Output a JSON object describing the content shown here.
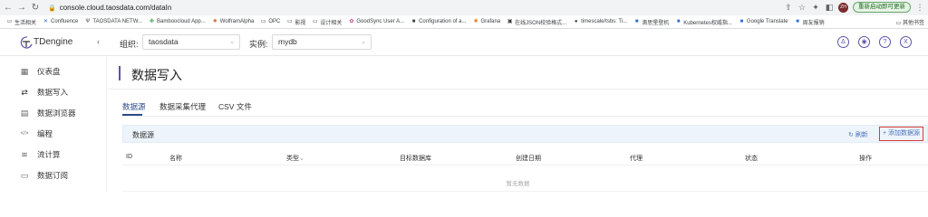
{
  "browser": {
    "url": "console.cloud.taosdata.com/dataIn",
    "update_button": "重新启动即可更新",
    "profile_initials": "ZH",
    "bookmarks": [
      "生活相关",
      "Confluence",
      "TAOSDATA NETW...",
      "Bamboocloud App...",
      "WolframAlpha",
      "OPC",
      "影视",
      "设计相关",
      "GoodSync User A...",
      "Configuration of a...",
      "Grafana",
      "在线JSON校验格式...",
      "timescale/tsbs: Ti...",
      "滴思堡登机",
      "Kubernetes权威指...",
      "Google Translate",
      "周友报销"
    ],
    "other_bookmarks": "其他书签"
  },
  "header": {
    "logo_text": "TDengine",
    "collapse_icon": "‹",
    "org_label": "组织:",
    "org_value": "taosdata",
    "instance_label": "实例:",
    "instance_value": "mydb",
    "icons": [
      "Δ",
      "◉",
      "?",
      "X"
    ]
  },
  "sidebar": {
    "items": [
      {
        "label": "仪表盘",
        "icon": "▦"
      },
      {
        "label": "数据写入",
        "icon": "⇄"
      },
      {
        "label": "数据浏览器",
        "icon": "▤"
      },
      {
        "label": "编程",
        "icon": "</>"
      },
      {
        "label": "流计算",
        "icon": "≋"
      },
      {
        "label": "数据订阅",
        "icon": "▭"
      }
    ]
  },
  "main": {
    "title": "数据写入",
    "tabs": [
      "数据源",
      "数据采集代理",
      "CSV 文件"
    ],
    "panel_title": "数据源",
    "refresh_label": "刷新",
    "add_label": "+ 添加数据源",
    "columns": [
      "ID",
      "名称",
      "类型",
      "目标数据库",
      "创建日期",
      "代理",
      "状态",
      "操作"
    ],
    "empty_text": "暂无数据"
  },
  "colors": {
    "accent": "#5b53a8",
    "highlight_border": "#d93a3a",
    "panel_bg": "#eef4fb"
  }
}
